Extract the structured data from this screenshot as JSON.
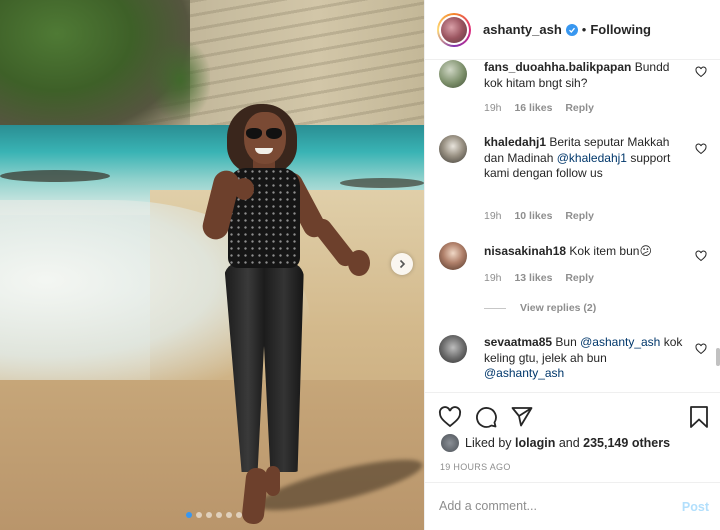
{
  "header": {
    "username": "ashanty_ash",
    "separator": "•",
    "follow_status": "Following"
  },
  "comments": [
    {
      "username": "fans_duoahha.balikpapan",
      "text": "Bundd kok hitam bngt sih?",
      "time": "19h",
      "likes": "16 likes",
      "reply": "Reply"
    },
    {
      "username": "khaledahj1",
      "text": "Berita seputar Makkah dan Madinah",
      "mention": "@khaledahj1",
      "text_after": "support kami dengan follow us",
      "time": "19h",
      "likes": "10 likes",
      "reply": "Reply"
    },
    {
      "username": "nisasakinah18",
      "text": "Kok item bun",
      "emoji": "😕",
      "time": "19h",
      "likes": "13 likes",
      "reply": "Reply",
      "view_replies": "View replies (2)"
    },
    {
      "username": "sevaatma85",
      "text": "Bun",
      "mention": "@ashanty_ash",
      "text_after": "kok keling gtu, jelek ah bun",
      "mention2": "@ashanty_ash"
    }
  ],
  "likes_summary": {
    "prefix": "Liked by",
    "user": "lolagin",
    "middle": "and",
    "count": "235,149 others"
  },
  "timestamp": "19 HOURS AGO",
  "add_comment": {
    "placeholder": "Add a comment...",
    "post_label": "Post"
  },
  "carousel": {
    "slide_count": 6,
    "active_index": 0
  },
  "colors": {
    "verified": "#3897f0",
    "mention": "#00376b",
    "post_disabled": "#b2dffc",
    "active_dot": "#3897f0"
  },
  "icons": [
    "verified-badge-icon",
    "heart-icon",
    "comment-icon",
    "share-icon",
    "bookmark-icon",
    "chevron-right-icon"
  ]
}
